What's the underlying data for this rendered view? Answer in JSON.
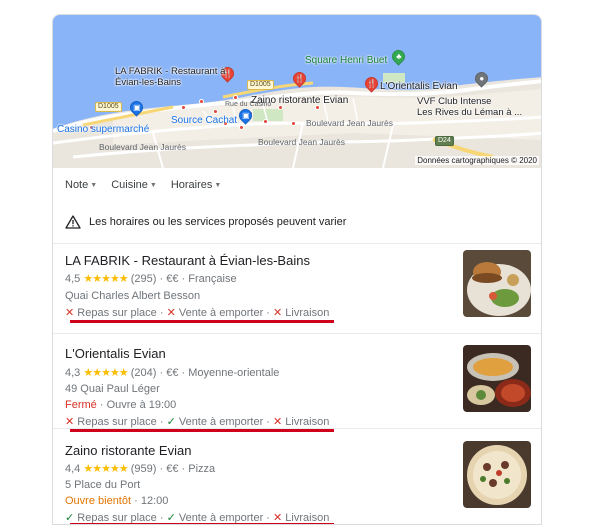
{
  "map": {
    "credit": "Données cartographiques © 2020",
    "labels": {
      "la_fabrik": "LA FABRIK - Restaurant à\nÉvian-les-Bains",
      "square": "Square Henri Buet",
      "orientalis": "L'Orientalis Evian",
      "zaino": "Zaino ristorante Evian",
      "vvf": "VVF Club Intense\nLes Rives du Léman à ...",
      "source": "Source Cachat",
      "casino": "Casino supermarché",
      "rue_du_casino": "Rue du Casino",
      "blvd1": "Boulevard Jean Jaurès",
      "blvd2": "Boulevard Jean Jaurès",
      "blvd3": "Boulevard Jean Jaurès"
    },
    "roads": {
      "d1005a": "D1005",
      "d1005b": "D1005",
      "d24": "D24"
    }
  },
  "filters": [
    {
      "label": "Note"
    },
    {
      "label": "Cuisine"
    },
    {
      "label": "Horaires"
    }
  ],
  "warning": "Les horaires ou les services proposés peuvent varier",
  "listings": [
    {
      "name": "LA FABRIK - Restaurant à Évian-les-Bains",
      "rating": "4,5",
      "stars": "★★★★★",
      "reviews": "(295)",
      "price": "€€",
      "category": "Française",
      "address": "Quai Charles Albert Besson",
      "services": [
        {
          "mark": "✕",
          "label": "Repas sur place"
        },
        {
          "mark": "✕",
          "label": "Vente à emporter"
        },
        {
          "mark": "✕",
          "label": "Livraison"
        }
      ]
    },
    {
      "name": "L'Orientalis Evian",
      "rating": "4,3",
      "stars": "★★★★★",
      "reviews": "(204)",
      "price": "€€",
      "category": "Moyenne-orientale",
      "address": "49 Quai Paul Léger",
      "status": "Fermé",
      "status_detail": "Ouvre à 19:00",
      "services": [
        {
          "mark": "✕",
          "label": "Repas sur place"
        },
        {
          "mark": "✓",
          "label": "Vente à emporter"
        },
        {
          "mark": "✕",
          "label": "Livraison"
        }
      ]
    },
    {
      "name": "Zaino ristorante Evian",
      "rating": "4,4",
      "stars": "★★★★★",
      "reviews": "(959)",
      "price": "€€",
      "category": "Pizza",
      "address": "5 Place du Port",
      "status": "Ouvre bientôt",
      "status_detail": "12:00",
      "services": [
        {
          "mark": "✓",
          "label": "Repas sur place"
        },
        {
          "mark": "✓",
          "label": "Vente à emporter"
        },
        {
          "mark": "✕",
          "label": "Livraison"
        }
      ]
    }
  ],
  "colors": {
    "water": "#8ab4f8",
    "star": "#fbbc04",
    "closed": "#d93025",
    "soon": "#e37400",
    "check": "#188038",
    "highlight": "#d0021b"
  },
  "separator": " · "
}
